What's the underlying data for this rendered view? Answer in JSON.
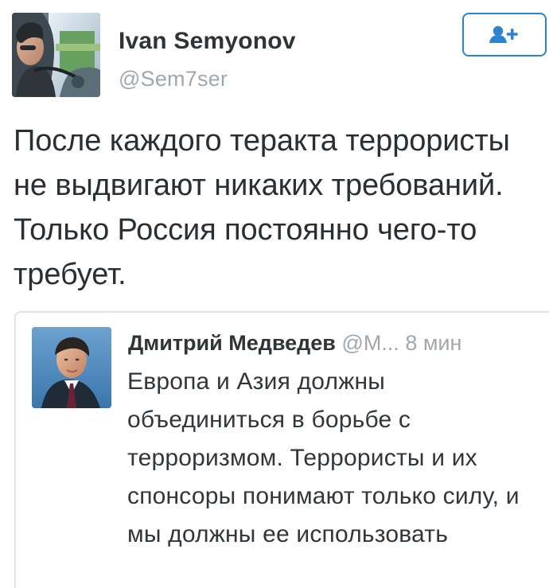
{
  "tweet": {
    "author": {
      "name": "Ivan Semyonov",
      "handle": "@Sem7ser",
      "avatar_icon": "driver-photo-avatar"
    },
    "follow_button": {
      "icon": "follow-user-icon",
      "accent": "#2c84d1"
    },
    "text": "После каждого теракта террористы не выдвигают никаких требований. Только Россия постоянно чего-то требует.",
    "quoted": {
      "author": {
        "name": "Дмитрий Медведев",
        "handle": "@М...",
        "time": "8 мин",
        "avatar_icon": "portrait-avatar"
      },
      "text": "Европа и Азия должны объединиться в борьбе с терроризмом. Террористы и их спонсоры понимают только силу, и мы должны ее использовать"
    }
  },
  "colors": {
    "name": "#2f3437",
    "muted": "#a0a7ad",
    "text": "#292f33",
    "border": "#dfe4e8",
    "accent": "#2c84d1"
  }
}
